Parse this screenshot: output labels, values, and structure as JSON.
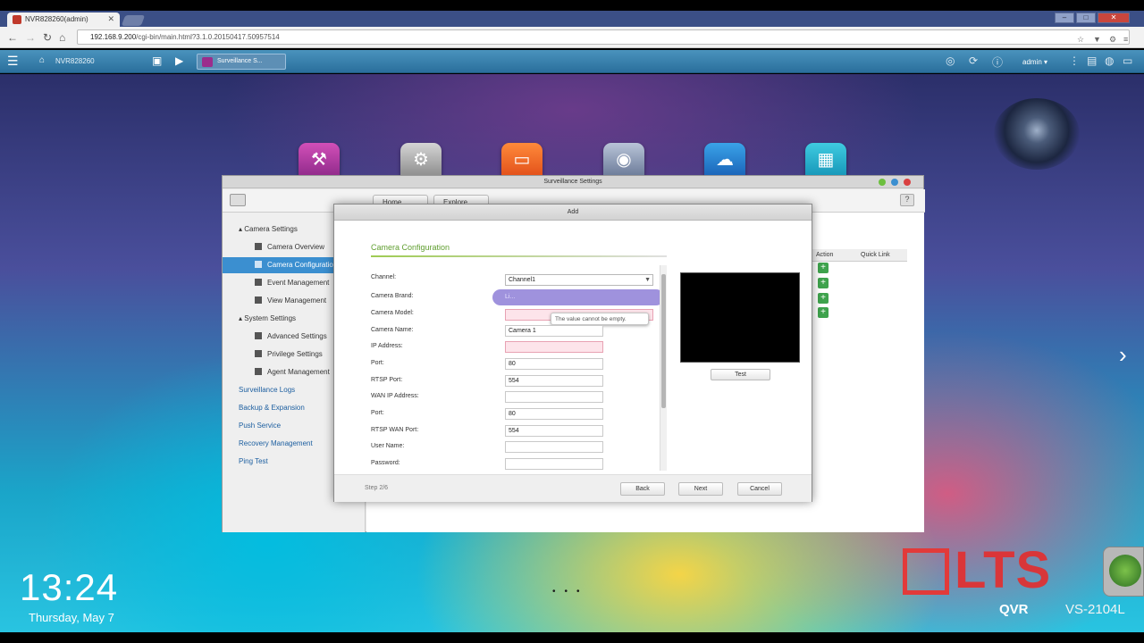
{
  "browser": {
    "tab_title": "NVR828260(admin)",
    "url_host": "192.168.9.200",
    "url_path": "/cgi-bin/main.html?3.1.0.20150417.50957514"
  },
  "nas_bar": {
    "device_name": "NVR828260",
    "task_label": "Surveillance S...",
    "user": "admin"
  },
  "settings_window": {
    "title": "Surveillance Settings",
    "toolbar": [
      "Home",
      "Explore"
    ],
    "sidebar": [
      {
        "label": "Camera Settings",
        "type": "section"
      },
      {
        "label": "Camera Overview",
        "type": "item"
      },
      {
        "label": "Camera Configuration",
        "type": "item",
        "selected": true
      },
      {
        "label": "Event Management",
        "type": "item"
      },
      {
        "label": "View Management",
        "type": "item"
      },
      {
        "label": "System Settings",
        "type": "section"
      },
      {
        "label": "Advanced Settings",
        "type": "item"
      },
      {
        "label": "Privilege Settings",
        "type": "item"
      },
      {
        "label": "Agent Management",
        "type": "item"
      },
      {
        "label": "Surveillance Logs",
        "type": "group"
      },
      {
        "label": "Backup & Expansion",
        "type": "group"
      },
      {
        "label": "Push Service",
        "type": "group"
      },
      {
        "label": "Recovery Management",
        "type": "group"
      },
      {
        "label": "Ping Test",
        "type": "group"
      }
    ],
    "columns": [
      "Action",
      "Quick Link"
    ]
  },
  "dialog": {
    "title": "Add",
    "section": "Camera Configuration",
    "fields": [
      {
        "label": "Channel:",
        "value": "Channel1"
      },
      {
        "label": "Camera Brand:",
        "value": "Li..."
      },
      {
        "label": "Camera Model:",
        "value": ""
      },
      {
        "label": "Camera Name:",
        "value": "Camera 1"
      },
      {
        "label": "IP Address:",
        "value": ""
      },
      {
        "label": "Port:",
        "value": "80"
      },
      {
        "label": "RTSP Port:",
        "value": "554"
      },
      {
        "label": "WAN IP Address:",
        "value": ""
      },
      {
        "label": "Port:",
        "value": "80"
      },
      {
        "label": "RTSP WAN Port:",
        "value": "554"
      },
      {
        "label": "User Name:",
        "value": ""
      },
      {
        "label": "Password:",
        "value": ""
      }
    ],
    "tooltip": "The value cannot be empty.",
    "test_button": "Test",
    "step_info": "Step 2/6",
    "buttons": {
      "back": "Back",
      "next": "Next",
      "cancel": "Cancel"
    }
  },
  "desktop": {
    "time": "13:24",
    "date": "Thursday, May 7",
    "brand": "LTS",
    "product": "QVR",
    "model": "VS-2104L"
  },
  "colors": {
    "accent_blue": "#3b8fd0",
    "section_green": "#5f9e2f",
    "brand_red": "#e23a3a"
  }
}
